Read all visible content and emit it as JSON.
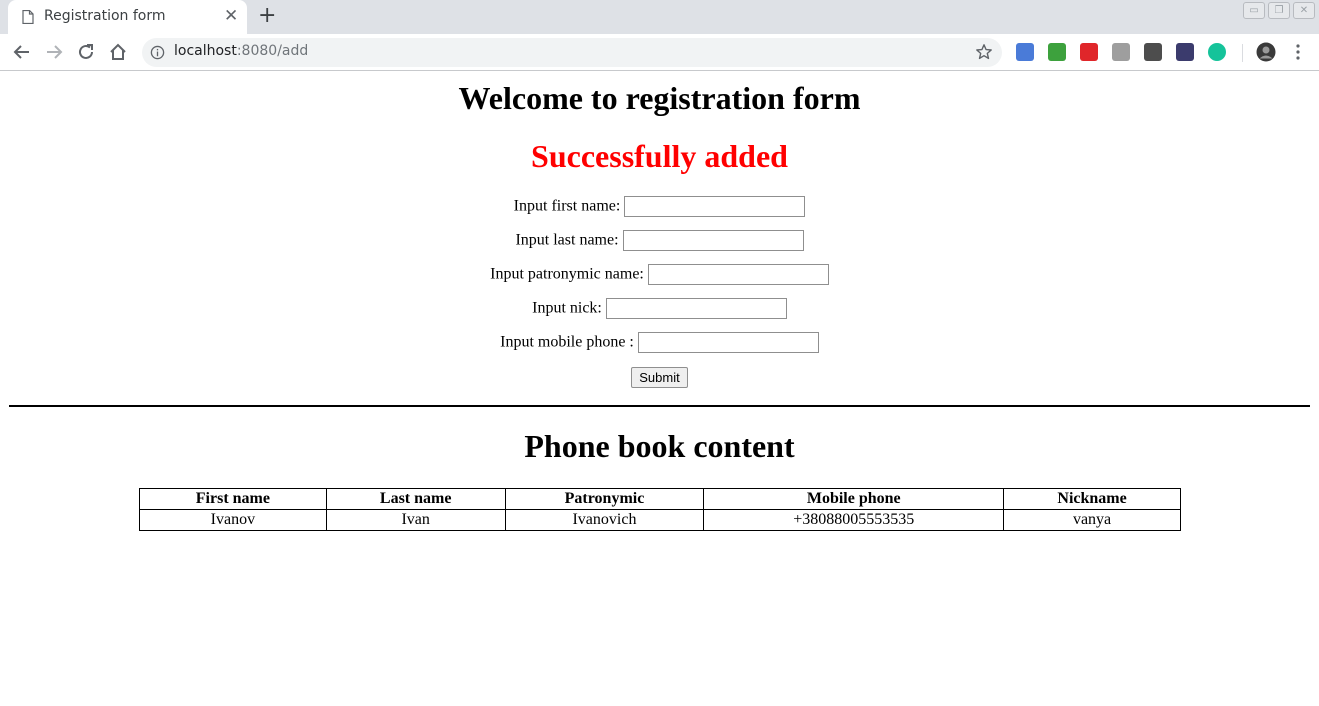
{
  "browser": {
    "tab_title": "Registration form",
    "tab_close": "✕",
    "new_tab": "+",
    "window_buttons": [
      "▭",
      "❐",
      "✕"
    ],
    "url_host": "localhost",
    "url_path": ":8080/add",
    "icons": {
      "back": "back-arrow-icon",
      "forward": "forward-arrow-icon",
      "reload": "reload-icon",
      "home": "home-icon",
      "info": "info-icon",
      "bookmark": "star-icon",
      "menu": "kebab-menu-icon"
    },
    "extensions": [
      {
        "name": "translate-extension-icon",
        "color": "#4a7bd8"
      },
      {
        "name": "download-green-extension-icon",
        "color": "#3da13d"
      },
      {
        "name": "adblock-extension-icon",
        "color": "#e0262a"
      },
      {
        "name": "user-extension-icon",
        "color": "#9e9e9e"
      },
      {
        "name": "download-extension-icon",
        "color": "#4d4d4d"
      },
      {
        "name": "shield-extension-icon",
        "color": "#3b3b6d"
      },
      {
        "name": "grammarly-extension-icon",
        "color": "#15c39a"
      }
    ]
  },
  "page": {
    "heading": "Welcome to registration form",
    "success_message": "Successfully added",
    "success_color": "#ff0000",
    "form": {
      "first_name_label": "Input first name:",
      "last_name_label": "Input last name:",
      "patronymic_label": "Input patronymic name:",
      "nick_label": "Input nick:",
      "mobile_label": "Input mobile phone :",
      "first_name_value": "",
      "last_name_value": "",
      "patronymic_value": "",
      "nick_value": "",
      "mobile_value": "",
      "submit_label": "Submit"
    },
    "phonebook_heading": "Phone book content",
    "table": {
      "columns": [
        "First name",
        "Last name",
        "Patronymic",
        "Mobile phone",
        "Nickname"
      ],
      "rows": [
        [
          "Ivanov",
          "Ivan",
          "Ivanovich",
          "+38088005553535",
          "vanya"
        ]
      ]
    }
  }
}
